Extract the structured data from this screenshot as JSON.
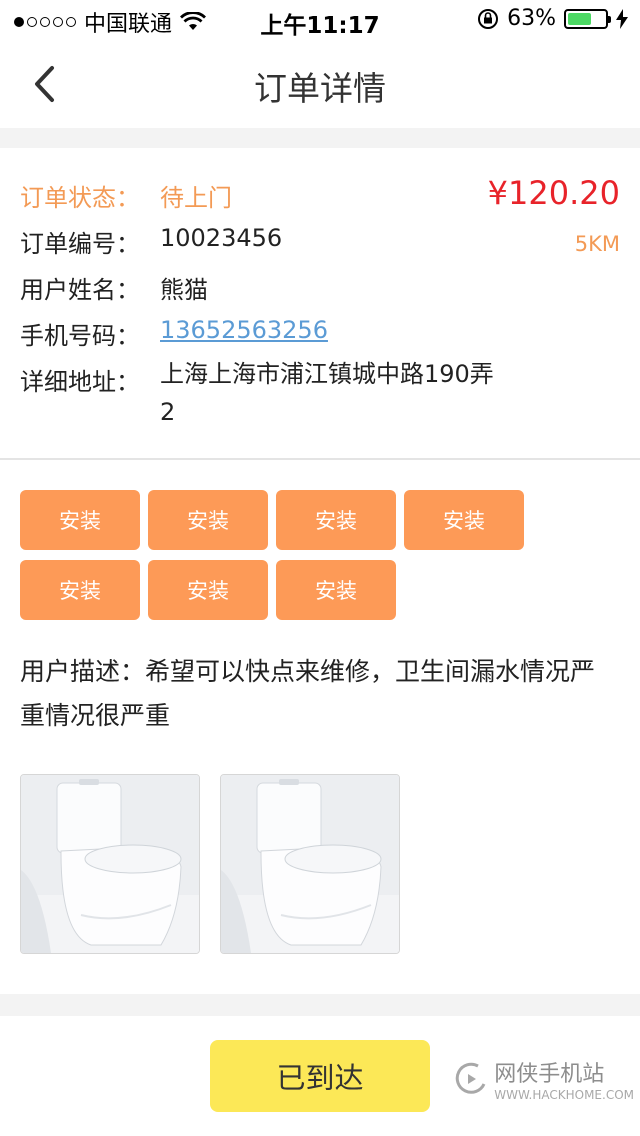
{
  "status_bar": {
    "carrier": "中国联通",
    "time": "上午11:17",
    "battery_text": "63%",
    "battery_level": 0.63,
    "signal_dots_filled": 1,
    "signal_dots_total": 5
  },
  "nav": {
    "title": "订单详情"
  },
  "order": {
    "status_label": "订单状态：",
    "status_value": "待上门",
    "price": "¥120.20",
    "distance": "5KM",
    "number_label": "订单编号：",
    "number_value": "10023456",
    "name_label": "用户姓名：",
    "name_value": "熊猫",
    "phone_label": "手机号码：",
    "phone_value": "13652563256",
    "address_label": "详细地址：",
    "address_value": "上海上海市浦江镇城中路190弄2"
  },
  "tags": [
    "安装",
    "安装",
    "安装",
    "安装",
    "安装",
    "安装",
    "安装"
  ],
  "description": {
    "label": "用户描述：",
    "text": "希望可以快点来维修，卫生间漏水情况严重情况很严重"
  },
  "photos": [
    "toilet-photo",
    "toilet-photo"
  ],
  "action": {
    "arrive_label": "已到达"
  },
  "watermark": {
    "cn": "网侠手机站",
    "en": "WWW.HACKHOME.COM"
  },
  "colors": {
    "accent_orange": "#fd9a57",
    "status_orange": "#f39a55",
    "price_red": "#e8232a",
    "link_blue": "#5b9bd5",
    "button_yellow": "#fce857"
  }
}
